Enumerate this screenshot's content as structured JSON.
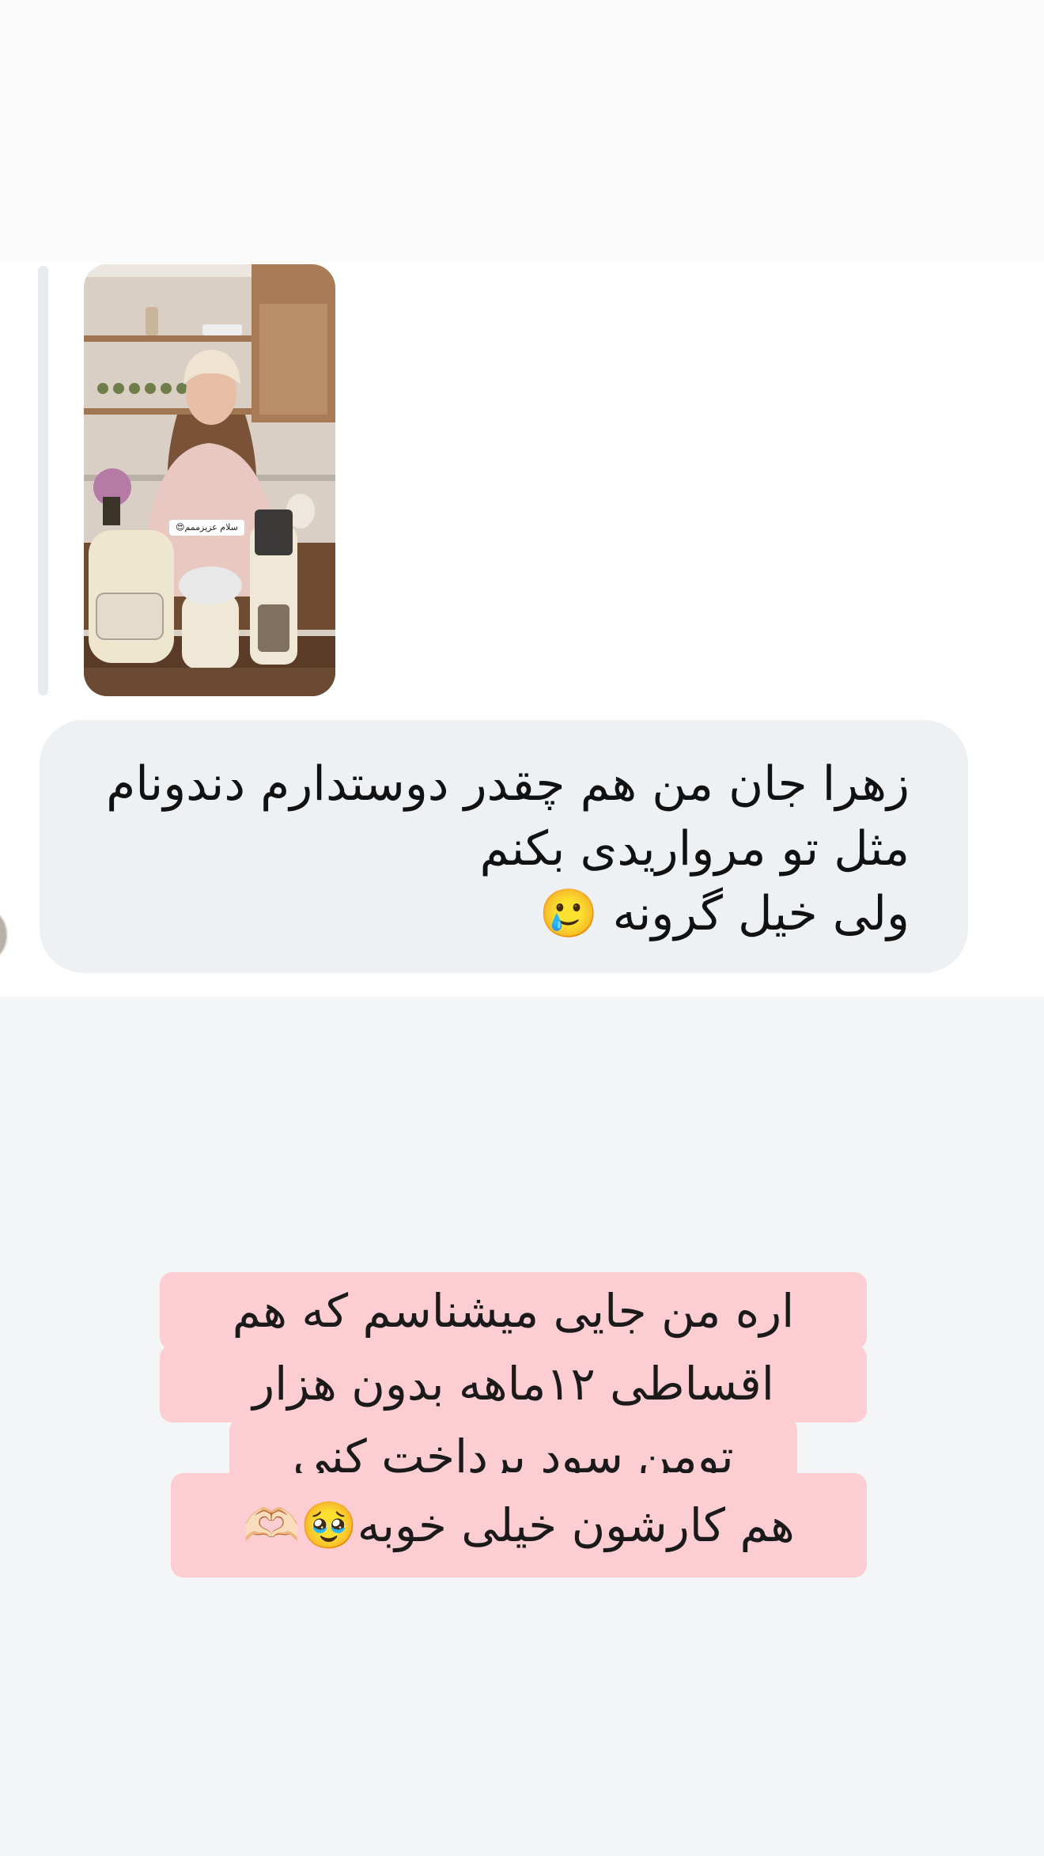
{
  "story_reply": {
    "sticker_text": "سلام عزیزممم😍"
  },
  "message": {
    "lines": [
      "زهرا جان من هم چقدر دوستدارم دندونام",
      "مثل تو مرواریدی بکنم",
      "ولی خیل گرونه"
    ],
    "emoji": "🥲"
  },
  "caption": {
    "lines": [
      "اره من جایی میشناسم که هم",
      "اقساطی ۱۲ماهه بدون هزار",
      "تومن سود پرداخت کنی",
      "هم کارشون خیلی خوبه🥹🫶🏻"
    ]
  },
  "colors": {
    "message_bubble": "#eef1f4",
    "caption_highlight": "#fccdd2",
    "background": "#f4f5f7"
  }
}
